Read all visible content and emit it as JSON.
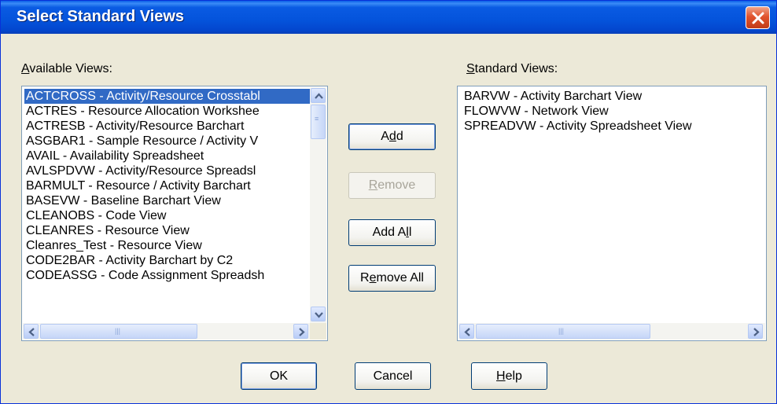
{
  "window": {
    "title": "Select Standard Views"
  },
  "available": {
    "label_pre": "",
    "label_mn": "A",
    "label_post": "vailable Views:",
    "items": [
      "ACTCROSS - Activity/Resource Crosstabl",
      "ACTRES - Resource Allocation Workshee",
      "ACTRESB - Activity/Resource Barchart",
      "ASGBAR1 - Sample Resource / Activity V",
      "AVAIL - Availability Spreadsheet",
      "AVLSPDVW - Activity/Resource Spreadsl",
      "BARMULT - Resource / Activity Barchart",
      "BASEVW - Baseline Barchart View",
      "CLEANOBS - Code View",
      "CLEANRES - Resource View",
      "Cleanres_Test - Resource View",
      "CODE2BAR - Activity Barchart by C2",
      "CODEASSG - Code Assignment Spreadsh"
    ],
    "selected_index": 0
  },
  "standard": {
    "label_pre": "",
    "label_mn": "S",
    "label_post": "tandard Views:",
    "items": [
      "BARVW - Activity Barchart View",
      "FLOWVW - Network View",
      "SPREADVW - Activity Spreadsheet View"
    ]
  },
  "buttons": {
    "add": {
      "pre": "A",
      "mn": "d",
      "post": "d"
    },
    "remove": {
      "pre": "",
      "mn": "R",
      "post": "emove"
    },
    "add_all": {
      "pre": "Add A",
      "mn": "l",
      "post": "l"
    },
    "remove_all": {
      "pre": "R",
      "mn": "e",
      "post": "move All"
    },
    "ok": {
      "pre": "OK",
      "mn": "",
      "post": ""
    },
    "cancel": {
      "pre": "Cancel",
      "mn": "",
      "post": ""
    },
    "help": {
      "pre": "",
      "mn": "H",
      "post": "elp"
    }
  },
  "colors": {
    "selection": "#316ac5",
    "title_bar": "#0453db",
    "face": "#ece9d8"
  },
  "icons": {
    "close": "close-icon",
    "up": "arrow-up-icon",
    "down": "arrow-down-icon",
    "left": "arrow-left-icon",
    "right": "arrow-right-icon"
  }
}
